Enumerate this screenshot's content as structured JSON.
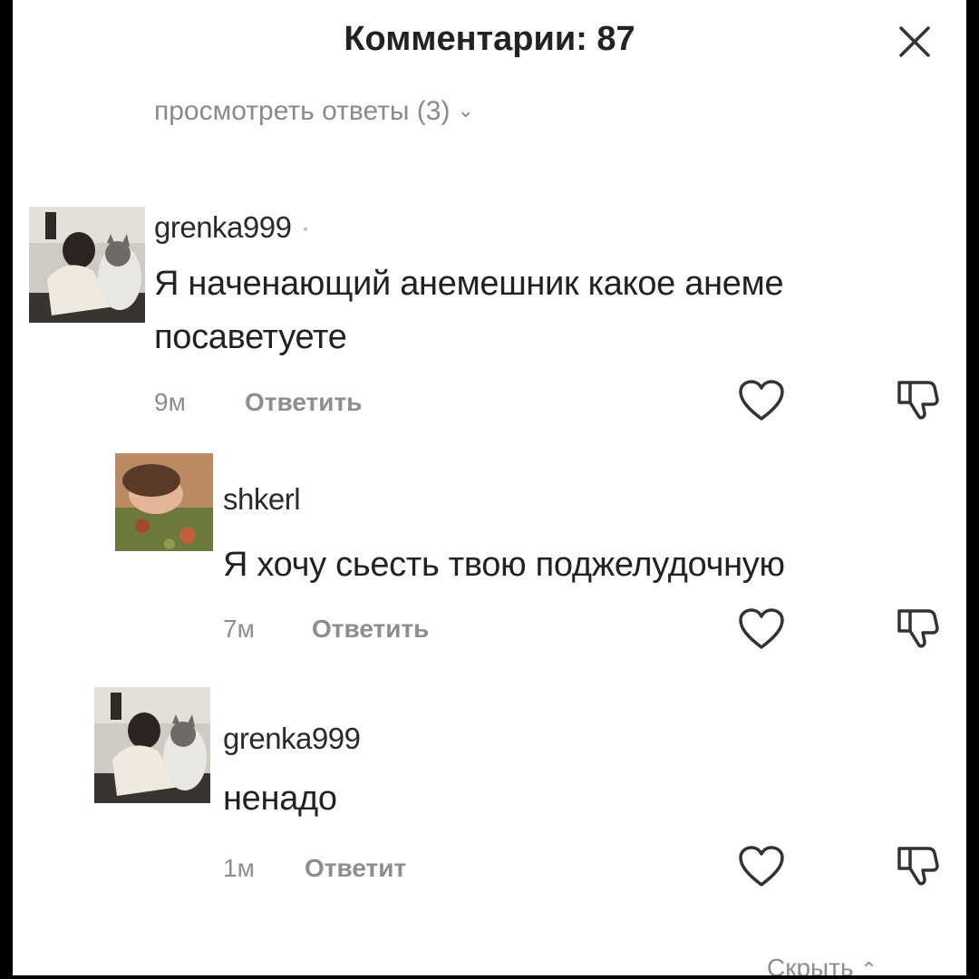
{
  "header": {
    "title": "Комментарии: 87"
  },
  "thread": {
    "view_replies": "просмотреть ответы (3)"
  },
  "comments": [
    {
      "username": "grenka999",
      "separator": "·",
      "text_line1": "Я наченающий анемешник какое анеме",
      "text_line2": "посаветуете",
      "time": "9м",
      "reply_label": "Ответить"
    },
    {
      "username": "shkerl",
      "text_line1": "Я хочу сьесть твою поджелудочную",
      "time": "7м",
      "reply_label": "Ответить"
    },
    {
      "username": "grenka999",
      "text_line1": "ненадо",
      "time": "1м",
      "reply_label": "Ответит"
    }
  ],
  "footer": {
    "hide_label": "Скрыть"
  },
  "colors": {
    "background": "#ffffff",
    "text": "#222222",
    "secondary_text": "#8e8e8e",
    "frame": "#000000"
  },
  "icons": [
    "close-icon",
    "chevron-down-icon",
    "heart-icon",
    "dislike-icon",
    "chevron-up-icon"
  ]
}
